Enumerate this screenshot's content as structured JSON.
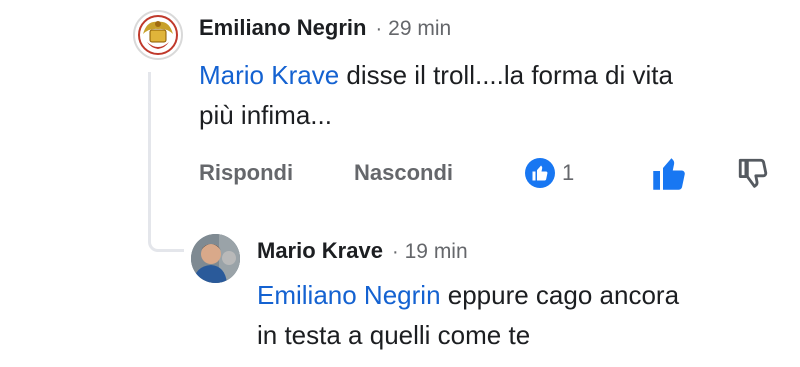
{
  "comment": {
    "author": "Emiliano Negrin",
    "separator": "·",
    "time": "29 min",
    "mention": "Mario Krave",
    "text_line1": " disse il troll....la forma di vita",
    "text_line2": "più infima...",
    "actions": {
      "reply_label": "Rispondi",
      "hide_label": "Nascondi",
      "like_count": "1"
    }
  },
  "reply": {
    "author": "Mario Krave",
    "separator": "·",
    "time": "19 min",
    "mention": "Emiliano Negrin",
    "text_line1": " eppure cago ancora",
    "text_line2": "in testa a quelli come te"
  },
  "icons": {
    "like_reaction": "like-reaction-icon",
    "thumb_up": "thumb-up-icon",
    "thumb_down": "thumb-down-icon"
  },
  "colors": {
    "mention": "#1462d1",
    "like_blue": "#1877f2",
    "muted": "#65676b",
    "text": "#1c1e21"
  }
}
